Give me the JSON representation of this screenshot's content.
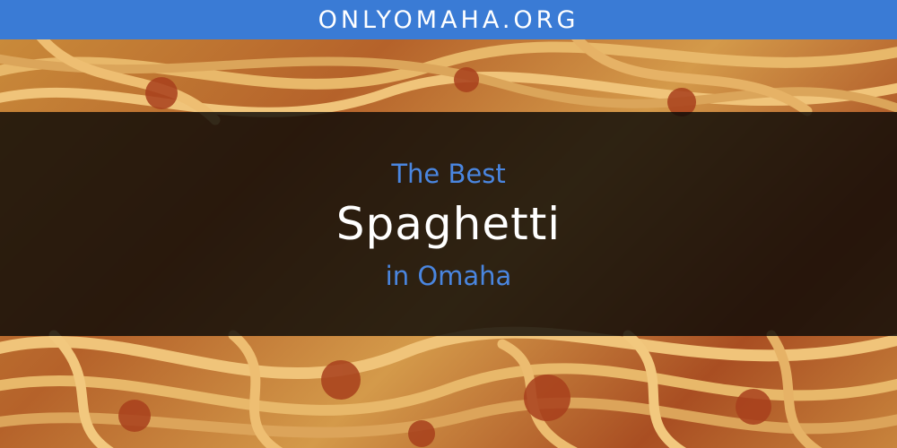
{
  "header": {
    "site_name": "ONLYOMAHA.ORG",
    "background": "#3a7bd5"
  },
  "hero": {
    "line_top": "The Best",
    "line_main": "Spaghetti",
    "line_bottom": "in Omaha",
    "accent_color": "#4a86e0",
    "main_color": "#ffffff"
  }
}
